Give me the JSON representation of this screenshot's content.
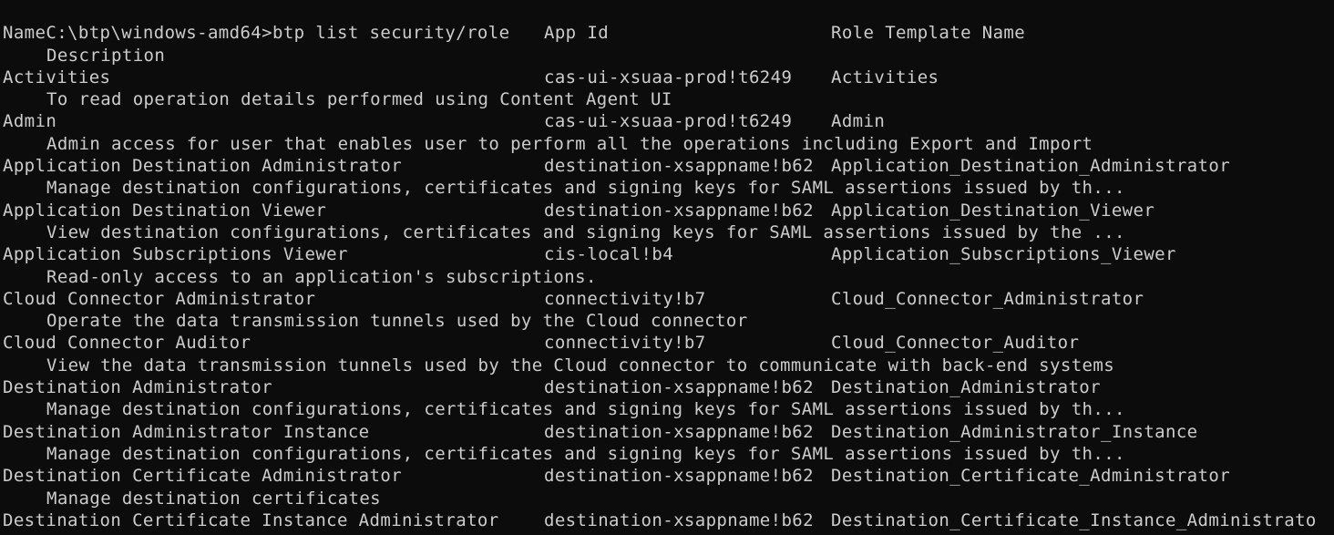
{
  "terminal": {
    "prompt": "C:\\btp\\windows-amd64>",
    "command": "btp list security/role"
  },
  "table": {
    "headers": {
      "name": "Name",
      "app_id": "App Id",
      "role_template": "Role Template Name",
      "description": "Description"
    },
    "rows": [
      {
        "name": "Activities",
        "app_id": "cas-ui-xsuaa-prod!t6249",
        "role_template": "Activities",
        "description": "To read operation details performed using Content Agent UI"
      },
      {
        "name": "Admin",
        "app_id": "cas-ui-xsuaa-prod!t6249",
        "role_template": "Admin",
        "description": "Admin access for user that enables user to perform all the operations including Export and Import"
      },
      {
        "name": "Application Destination Administrator",
        "app_id": "destination-xsappname!b62",
        "role_template": "Application_Destination_Administrator",
        "description": "Manage destination configurations, certificates and signing keys for SAML assertions issued by th..."
      },
      {
        "name": "Application Destination Viewer",
        "app_id": "destination-xsappname!b62",
        "role_template": "Application_Destination_Viewer",
        "description": "View destination configurations, certificates and signing keys for SAML assertions issued by the ..."
      },
      {
        "name": "Application Subscriptions Viewer",
        "app_id": "cis-local!b4",
        "role_template": "Application_Subscriptions_Viewer",
        "description": "Read-only access to an application's subscriptions."
      },
      {
        "name": "Cloud Connector Administrator",
        "app_id": "connectivity!b7",
        "role_template": "Cloud_Connector_Administrator",
        "description": "Operate the data transmission tunnels used by the Cloud connector"
      },
      {
        "name": "Cloud Connector Auditor",
        "app_id": "connectivity!b7",
        "role_template": "Cloud_Connector_Auditor",
        "description": "View the data transmission tunnels used by the Cloud connector to communicate with back-end systems"
      },
      {
        "name": "Destination Administrator",
        "app_id": "destination-xsappname!b62",
        "role_template": "Destination_Administrator",
        "description": "Manage destination configurations, certificates and signing keys for SAML assertions issued by th..."
      },
      {
        "name": "Destination Administrator Instance",
        "app_id": "destination-xsappname!b62",
        "role_template": "Destination_Administrator_Instance",
        "description": "Manage destination configurations, certificates and signing keys for SAML assertions issued by th..."
      },
      {
        "name": "Destination Certificate Administrator",
        "app_id": "destination-xsappname!b62",
        "role_template": "Destination_Certificate_Administrator",
        "description": "Manage destination certificates"
      },
      {
        "name": "Destination Certificate Instance Administrator",
        "app_id": "destination-xsappname!b62",
        "role_template": "Destination_Certificate_Instance_Administrato",
        "description": ""
      }
    ]
  }
}
